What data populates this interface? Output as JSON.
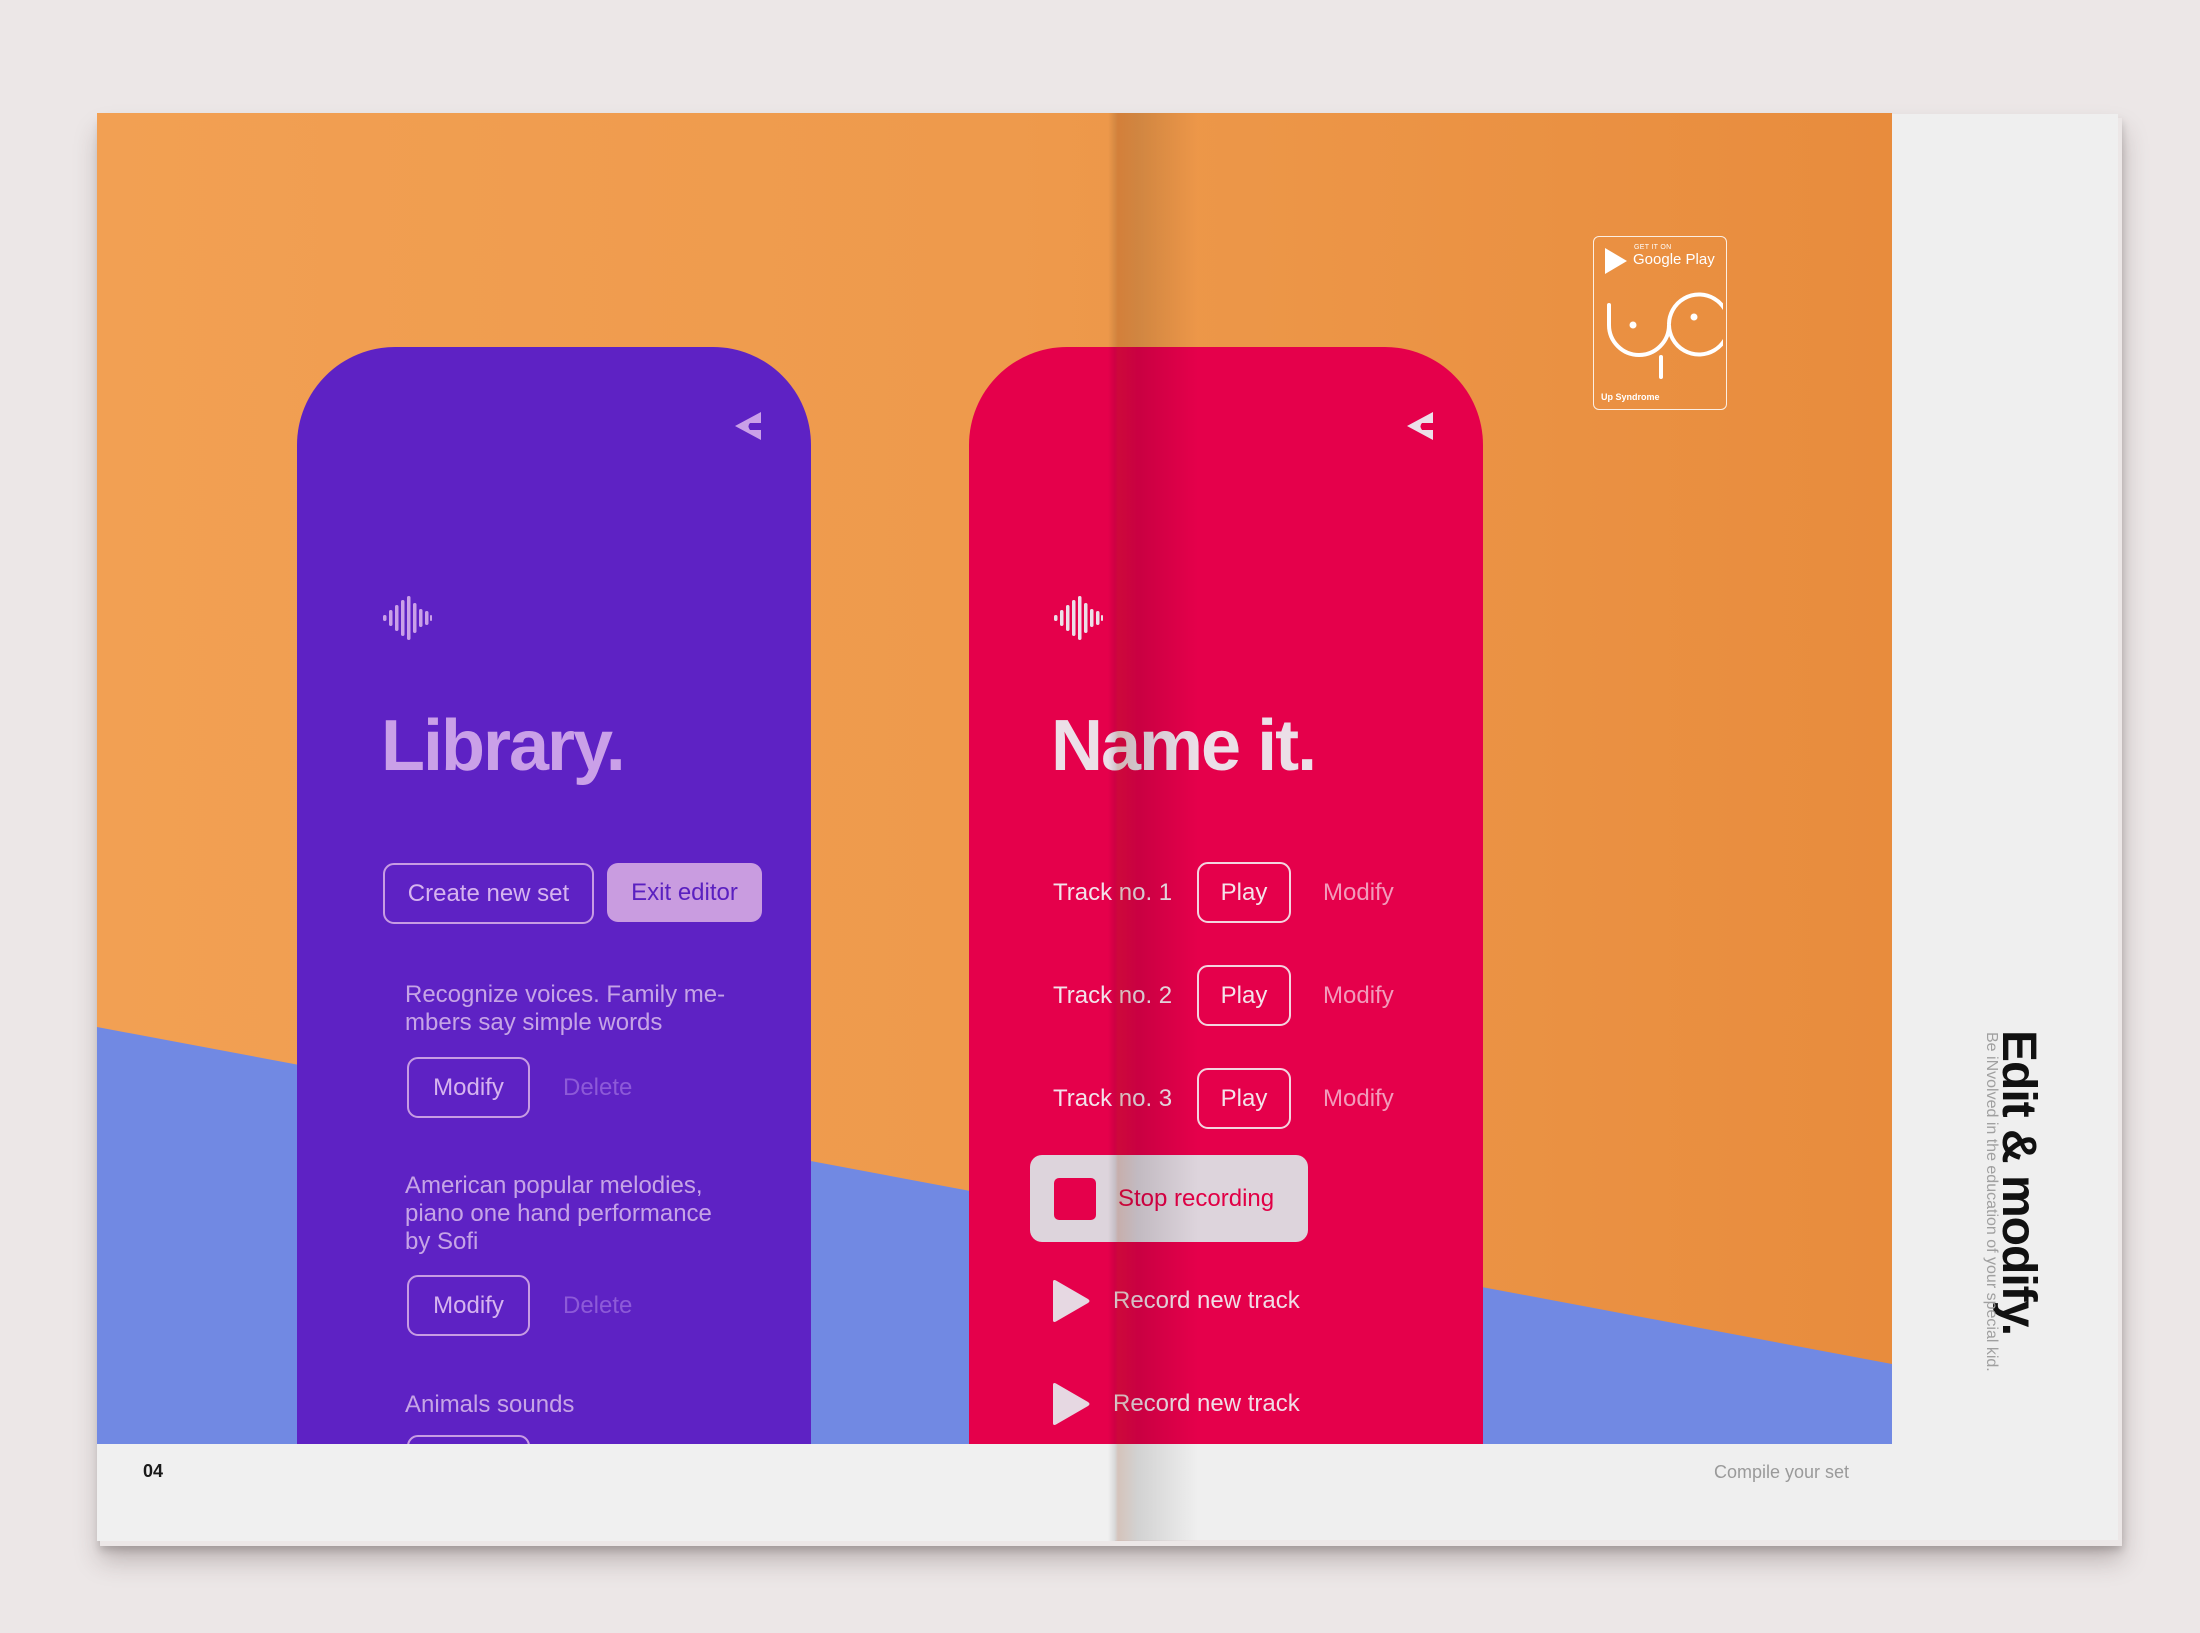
{
  "colors": {
    "orange": "#ef9a4c",
    "blue": "#7189e3",
    "purple": "#5e22c4",
    "lilac": "#c99ce0",
    "red": "#e5004b",
    "paper": "#f0f0f0"
  },
  "left_page": {
    "page_number": "04"
  },
  "right_page": {
    "footer_section": "Compile your set",
    "side_title": "Edit & modify.",
    "side_subtitle": "Be iNvolved in the education of your special kid."
  },
  "badge": {
    "get_it_on": "GET IT ON",
    "store": "Google Play",
    "app_name": "Up Syndrome",
    "icons": [
      "play-store-icon",
      "up-syndrome-logo"
    ]
  },
  "library_screen": {
    "icons": [
      "back-icon",
      "waveform-icon"
    ],
    "title": "Library.",
    "create_button": "Create new set",
    "exit_button": "Exit editor",
    "sets": [
      {
        "line1": "Recognize voices. Family me-",
        "line2": "mbers say simple words",
        "line3": "",
        "modify": "Modify",
        "delete": "Delete"
      },
      {
        "line1": "American popular melodies,",
        "line2": "piano one hand performance",
        "line3": "by Sofi",
        "modify": "Modify",
        "delete": "Delete"
      },
      {
        "line1": "Animals sounds",
        "line2": "",
        "line3": "",
        "modify": "",
        "delete": ""
      }
    ]
  },
  "name_screen": {
    "icons": [
      "back-icon",
      "waveform-icon",
      "stop-icon",
      "play-icon"
    ],
    "title": "Name it.",
    "tracks": [
      {
        "label": "Track no. 1",
        "play": "Play",
        "modify": "Modify"
      },
      {
        "label": "Track no. 2",
        "play": "Play",
        "modify": "Modify"
      },
      {
        "label": "Track no. 3",
        "play": "Play",
        "modify": "Modify"
      }
    ],
    "stop_recording": "Stop recording",
    "record_items": [
      "Record new track",
      "Record new track"
    ]
  }
}
